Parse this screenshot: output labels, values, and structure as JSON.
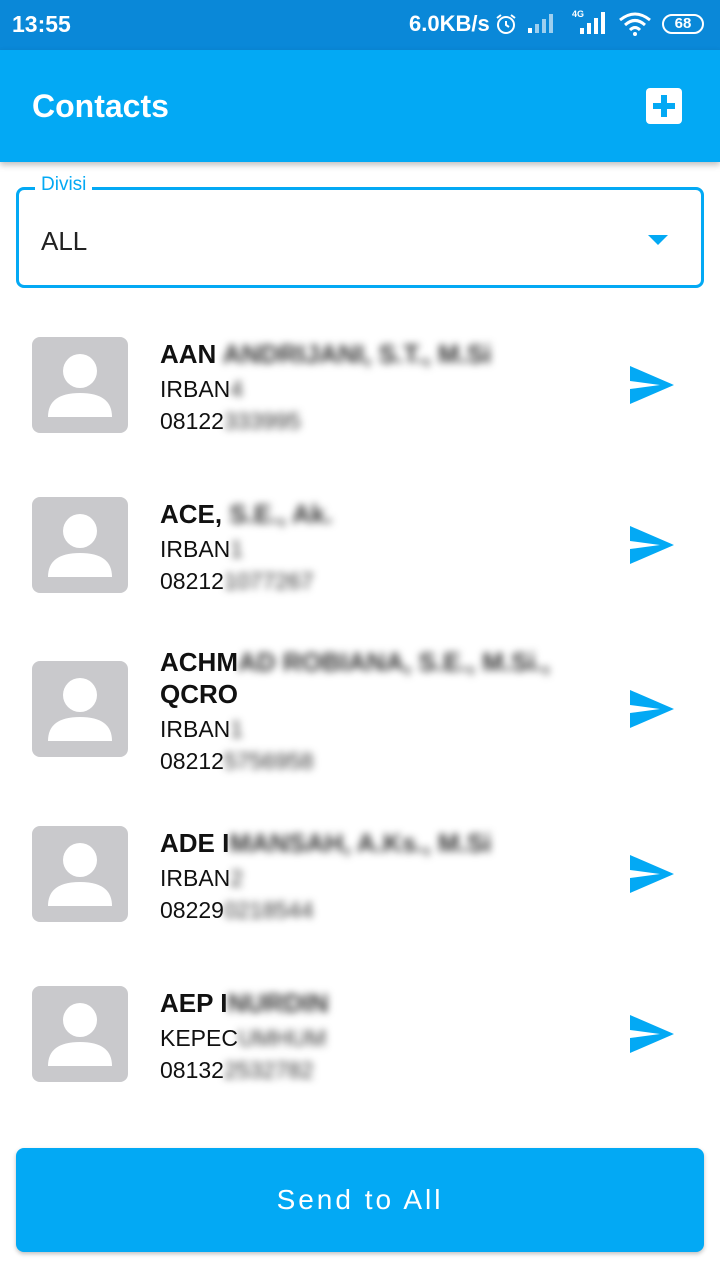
{
  "status_bar": {
    "time": "13:55",
    "network_speed": "6.0KB/s",
    "battery": "68",
    "icons": [
      "alarm-icon",
      "signal-icon",
      "4g-signal-icon",
      "wifi-icon",
      "battery-icon"
    ],
    "network_label": "4G"
  },
  "app_bar": {
    "title": "Contacts",
    "add_icon": "plus-icon"
  },
  "filter": {
    "label": "Divisi",
    "value": "ALL"
  },
  "contacts": [
    {
      "name_visible": "AAN",
      "name_blurred": "ANDRIJANI, S.T., M.Si",
      "division_visible": "IRBAN",
      "division_blurred": "4",
      "phone_visible": "08122",
      "phone_blurred": "333995"
    },
    {
      "name_visible": "ACE,",
      "name_blurred": "S.E., Ak.",
      "division_visible": "IRBAN",
      "division_blurred": "1",
      "phone_visible": "08212",
      "phone_blurred": "1077267"
    },
    {
      "name_visible": "ACHM",
      "name_blurred": "AD ROBIANA, S.E., M.Si.,",
      "name_line2_visible": "QCRO",
      "division_visible": "IRBAN",
      "division_blurred": "1",
      "phone_visible": "08212",
      "phone_blurred": "5756958"
    },
    {
      "name_visible": "ADE I",
      "name_blurred": "MANSAH, A.Ks., M.Si",
      "division_visible": "IRBAN",
      "division_blurred": "2",
      "phone_visible": "08229",
      "phone_blurred": "0218544"
    },
    {
      "name_visible": "AEP I",
      "name_blurred": "NURDIN",
      "division_visible": "KEPEC",
      "division_blurred": "UMHUM",
      "phone_visible": "08132",
      "phone_blurred": "2532782"
    }
  ],
  "send_all_label": "Send to All",
  "colors": {
    "primary": "#03a9f4",
    "status_bar": "#0a88d8",
    "avatar_bg": "#c9c9cc"
  }
}
